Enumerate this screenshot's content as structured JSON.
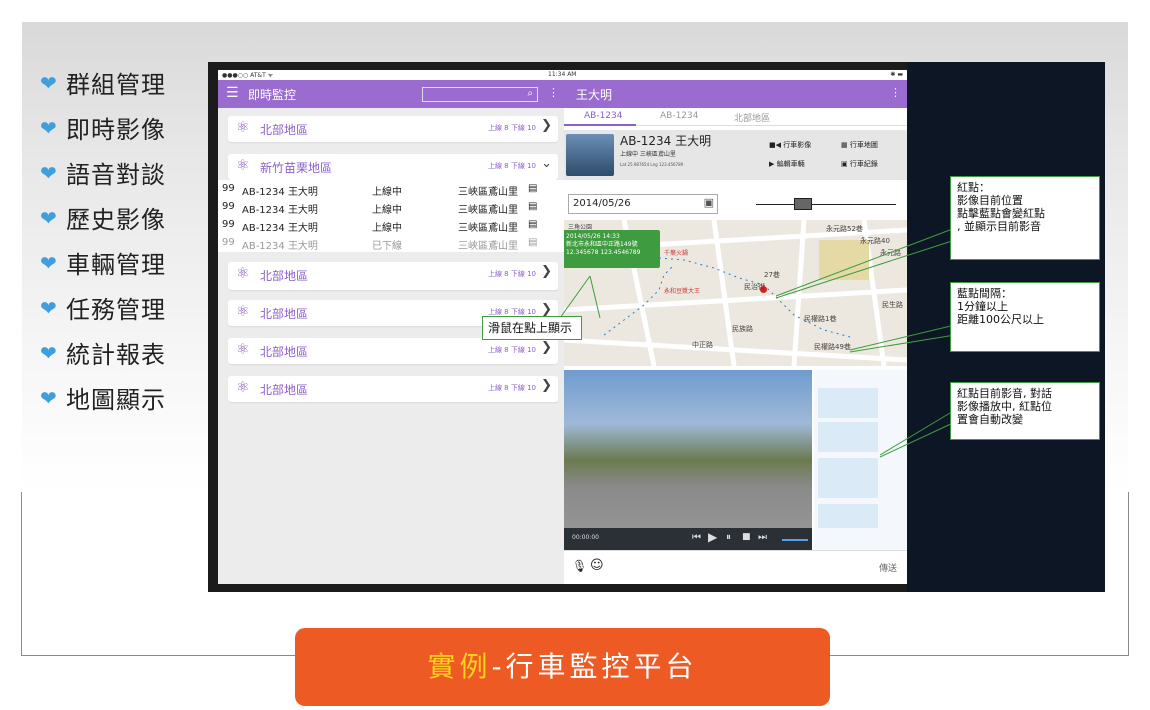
{
  "menu": {
    "items": [
      {
        "label": "群組管理"
      },
      {
        "label": "即時影像"
      },
      {
        "label": "語音對談"
      },
      {
        "label": "歷史影像"
      },
      {
        "label": "車輛管理"
      },
      {
        "label": "任務管理"
      },
      {
        "label": "統計報表"
      },
      {
        "label": "地圖顯示"
      }
    ],
    "bullet_icon": "heart-icon",
    "bullet_color": "#3f9fdd"
  },
  "statusbar": {
    "carrier": "●●●○○ AT&T ᯤ",
    "time": "11:34 AM",
    "battery": "✱ ▬"
  },
  "left_header": {
    "title": "即時監控",
    "search_placeholder": "",
    "accent": "#9b6ccf"
  },
  "groups": [
    {
      "name": "北部地區",
      "stat": "上線 8  下線 10",
      "expanded": false
    },
    {
      "name": "新竹苗栗地區",
      "stat": "上線 8  下線 10",
      "expanded": true,
      "vehicles": [
        {
          "num": "99",
          "plate": "AB-1234 王大明",
          "status": "上線中",
          "location": "三峽區鳶山里"
        },
        {
          "num": "99",
          "plate": "AB-1234 王大明",
          "status": "上線中",
          "location": "三峽區鳶山里"
        },
        {
          "num": "99",
          "plate": "AB-1234 王大明",
          "status": "上線中",
          "location": "三峽區鳶山里"
        },
        {
          "num": "99",
          "plate": "AB-1234 王大明",
          "status": "已下線",
          "location": "三峽區鳶山里"
        }
      ]
    },
    {
      "name": "北部地區",
      "stat": "上線 8  下線 10",
      "expanded": false
    },
    {
      "name": "北部地區",
      "stat": "上線 8  下線 10",
      "expanded": false
    },
    {
      "name": "北部地區",
      "stat": "上線 8  下線 10",
      "expanded": false
    },
    {
      "name": "北部地區",
      "stat": "上線 8  下線 10",
      "expanded": false
    }
  ],
  "right_header": {
    "title": "王大明"
  },
  "tabs": [
    "AB-1234",
    "AB-1234",
    "北部地區"
  ],
  "vehicle_card": {
    "title": "AB-1234  王大明",
    "status_line": "上線中   三峽區鳶山里",
    "coords": "Lat 25.987654   Lng 123.456789",
    "buttons": [
      "行車影像",
      "行車地圖",
      "編輯車輛",
      "行車紀錄"
    ]
  },
  "date_field": {
    "value": "2014/05/26"
  },
  "map_popup": {
    "lines": [
      "2014/05/26 14:33",
      "新北市永和區中正路149號",
      "12.345678 123.4546789"
    ]
  },
  "hover_hint": "滑鼠在點上顯示",
  "map_labels": [
    "永元路52巷",
    "永元路40",
    "永元路",
    "民生路",
    "民權路1巷",
    "民權路49巷",
    "永和豆漿大王",
    "27巷",
    "民族路",
    "民治街",
    "三角公園",
    "中正路",
    "千葉火鍋"
  ],
  "video": {
    "time": "00:00:00",
    "controls": [
      "⏮",
      "▶",
      "⏸",
      "■",
      "⏭"
    ]
  },
  "chat_send": "傳送",
  "annotations": [
    {
      "text": "紅點：\n影像目前位置\n點擊藍點會變紅點\n, 並顯示目前影音"
    },
    {
      "text": "藍點間隔：\n1分鐘以上\n距離100公尺以上"
    },
    {
      "text": "紅點目前影音, 對話\n影像播放中, 紅點位\n置會自動改變"
    }
  ],
  "banner": {
    "highlight": "實例",
    "rest": "-行車監控平台"
  },
  "colors": {
    "purple": "#9b6ccf",
    "banner": "#ee5a24",
    "banner_highlight": "#ffd21f",
    "callout_border": "#3f9b3f"
  }
}
